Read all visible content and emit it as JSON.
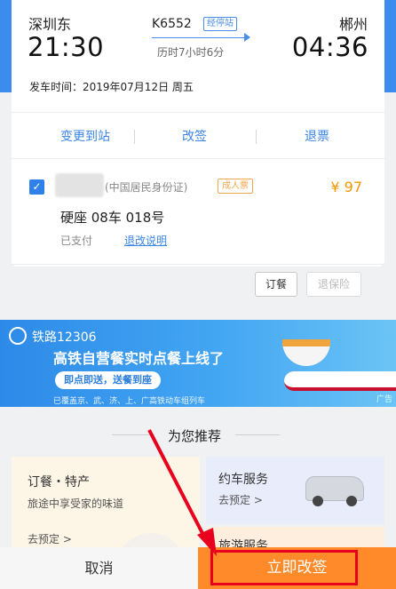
{
  "trip": {
    "from_station": "深圳东",
    "to_station": "郴州",
    "depart_time": "21:30",
    "arrive_time": "04:36",
    "train_no": "K6552",
    "via_badge": "经停站",
    "duration": "历时7小时6分",
    "depart_date": "发车时间：2019年07月12日 周五"
  },
  "tabs": [
    {
      "label": "变更到站"
    },
    {
      "label": "改签"
    },
    {
      "label": "退票"
    }
  ],
  "passenger": {
    "id_type": "(中国居民身份证)",
    "ticket_type": "成人票",
    "price": "¥ 97",
    "seat": "硬座 08车 018号",
    "status": "已支付",
    "refund_info": "退改说明"
  },
  "actions": {
    "order_meal": "订餐",
    "refund_insurance": "退保险"
  },
  "banner": {
    "logo_text": "铁路12306",
    "headline": "高铁自营餐实时点餐上线了",
    "pill": "即点即送，送餐到座",
    "footnote": "已覆盖京、武、济、上、广高铁动车组列车",
    "ad_tag": "广告"
  },
  "recommend": {
    "title": "为您推荐",
    "food_title": "订餐・特产",
    "food_sub": "旅途中享受家的味道",
    "food_cta": "去预定 >",
    "car_title": "约车服务",
    "car_cta": "去预定 >",
    "travel_title": "旅游服务"
  },
  "bottom": {
    "cancel": "取消",
    "confirm": "立即改签"
  },
  "colors": {
    "primary_blue": "#3c8cef",
    "accent_orange": "#ff8a2a",
    "price_orange": "#f39800",
    "highlight_red": "#e8001c"
  }
}
